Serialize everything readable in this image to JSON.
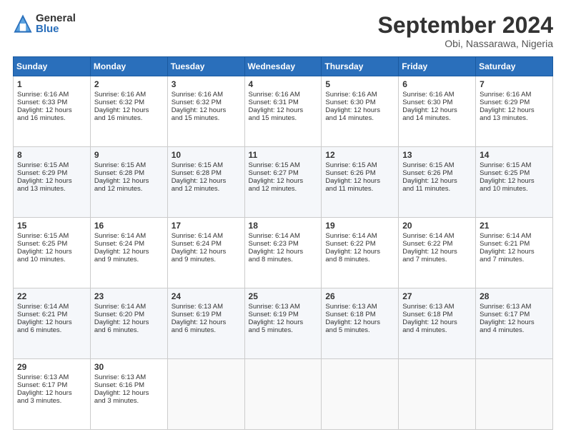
{
  "logo": {
    "general": "General",
    "blue": "Blue"
  },
  "title": "September 2024",
  "location": "Obi, Nassarawa, Nigeria",
  "days_of_week": [
    "Sunday",
    "Monday",
    "Tuesday",
    "Wednesday",
    "Thursday",
    "Friday",
    "Saturday"
  ],
  "weeks": [
    [
      {
        "day": "1",
        "lines": [
          "Sunrise: 6:16 AM",
          "Sunset: 6:33 PM",
          "Daylight: 12 hours",
          "and 16 minutes."
        ]
      },
      {
        "day": "2",
        "lines": [
          "Sunrise: 6:16 AM",
          "Sunset: 6:32 PM",
          "Daylight: 12 hours",
          "and 16 minutes."
        ]
      },
      {
        "day": "3",
        "lines": [
          "Sunrise: 6:16 AM",
          "Sunset: 6:32 PM",
          "Daylight: 12 hours",
          "and 15 minutes."
        ]
      },
      {
        "day": "4",
        "lines": [
          "Sunrise: 6:16 AM",
          "Sunset: 6:31 PM",
          "Daylight: 12 hours",
          "and 15 minutes."
        ]
      },
      {
        "day": "5",
        "lines": [
          "Sunrise: 6:16 AM",
          "Sunset: 6:30 PM",
          "Daylight: 12 hours",
          "and 14 minutes."
        ]
      },
      {
        "day": "6",
        "lines": [
          "Sunrise: 6:16 AM",
          "Sunset: 6:30 PM",
          "Daylight: 12 hours",
          "and 14 minutes."
        ]
      },
      {
        "day": "7",
        "lines": [
          "Sunrise: 6:16 AM",
          "Sunset: 6:29 PM",
          "Daylight: 12 hours",
          "and 13 minutes."
        ]
      }
    ],
    [
      {
        "day": "8",
        "lines": [
          "Sunrise: 6:15 AM",
          "Sunset: 6:29 PM",
          "Daylight: 12 hours",
          "and 13 minutes."
        ]
      },
      {
        "day": "9",
        "lines": [
          "Sunrise: 6:15 AM",
          "Sunset: 6:28 PM",
          "Daylight: 12 hours",
          "and 12 minutes."
        ]
      },
      {
        "day": "10",
        "lines": [
          "Sunrise: 6:15 AM",
          "Sunset: 6:28 PM",
          "Daylight: 12 hours",
          "and 12 minutes."
        ]
      },
      {
        "day": "11",
        "lines": [
          "Sunrise: 6:15 AM",
          "Sunset: 6:27 PM",
          "Daylight: 12 hours",
          "and 12 minutes."
        ]
      },
      {
        "day": "12",
        "lines": [
          "Sunrise: 6:15 AM",
          "Sunset: 6:26 PM",
          "Daylight: 12 hours",
          "and 11 minutes."
        ]
      },
      {
        "day": "13",
        "lines": [
          "Sunrise: 6:15 AM",
          "Sunset: 6:26 PM",
          "Daylight: 12 hours",
          "and 11 minutes."
        ]
      },
      {
        "day": "14",
        "lines": [
          "Sunrise: 6:15 AM",
          "Sunset: 6:25 PM",
          "Daylight: 12 hours",
          "and 10 minutes."
        ]
      }
    ],
    [
      {
        "day": "15",
        "lines": [
          "Sunrise: 6:15 AM",
          "Sunset: 6:25 PM",
          "Daylight: 12 hours",
          "and 10 minutes."
        ]
      },
      {
        "day": "16",
        "lines": [
          "Sunrise: 6:14 AM",
          "Sunset: 6:24 PM",
          "Daylight: 12 hours",
          "and 9 minutes."
        ]
      },
      {
        "day": "17",
        "lines": [
          "Sunrise: 6:14 AM",
          "Sunset: 6:24 PM",
          "Daylight: 12 hours",
          "and 9 minutes."
        ]
      },
      {
        "day": "18",
        "lines": [
          "Sunrise: 6:14 AM",
          "Sunset: 6:23 PM",
          "Daylight: 12 hours",
          "and 8 minutes."
        ]
      },
      {
        "day": "19",
        "lines": [
          "Sunrise: 6:14 AM",
          "Sunset: 6:22 PM",
          "Daylight: 12 hours",
          "and 8 minutes."
        ]
      },
      {
        "day": "20",
        "lines": [
          "Sunrise: 6:14 AM",
          "Sunset: 6:22 PM",
          "Daylight: 12 hours",
          "and 7 minutes."
        ]
      },
      {
        "day": "21",
        "lines": [
          "Sunrise: 6:14 AM",
          "Sunset: 6:21 PM",
          "Daylight: 12 hours",
          "and 7 minutes."
        ]
      }
    ],
    [
      {
        "day": "22",
        "lines": [
          "Sunrise: 6:14 AM",
          "Sunset: 6:21 PM",
          "Daylight: 12 hours",
          "and 6 minutes."
        ]
      },
      {
        "day": "23",
        "lines": [
          "Sunrise: 6:14 AM",
          "Sunset: 6:20 PM",
          "Daylight: 12 hours",
          "and 6 minutes."
        ]
      },
      {
        "day": "24",
        "lines": [
          "Sunrise: 6:13 AM",
          "Sunset: 6:19 PM",
          "Daylight: 12 hours",
          "and 6 minutes."
        ]
      },
      {
        "day": "25",
        "lines": [
          "Sunrise: 6:13 AM",
          "Sunset: 6:19 PM",
          "Daylight: 12 hours",
          "and 5 minutes."
        ]
      },
      {
        "day": "26",
        "lines": [
          "Sunrise: 6:13 AM",
          "Sunset: 6:18 PM",
          "Daylight: 12 hours",
          "and 5 minutes."
        ]
      },
      {
        "day": "27",
        "lines": [
          "Sunrise: 6:13 AM",
          "Sunset: 6:18 PM",
          "Daylight: 12 hours",
          "and 4 minutes."
        ]
      },
      {
        "day": "28",
        "lines": [
          "Sunrise: 6:13 AM",
          "Sunset: 6:17 PM",
          "Daylight: 12 hours",
          "and 4 minutes."
        ]
      }
    ],
    [
      {
        "day": "29",
        "lines": [
          "Sunrise: 6:13 AM",
          "Sunset: 6:17 PM",
          "Daylight: 12 hours",
          "and 3 minutes."
        ]
      },
      {
        "day": "30",
        "lines": [
          "Sunrise: 6:13 AM",
          "Sunset: 6:16 PM",
          "Daylight: 12 hours",
          "and 3 minutes."
        ]
      },
      null,
      null,
      null,
      null,
      null
    ]
  ]
}
